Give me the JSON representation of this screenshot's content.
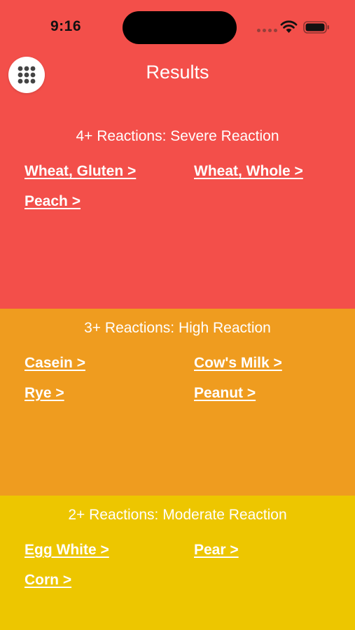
{
  "status": {
    "time": "9:16"
  },
  "header": {
    "title": "Results",
    "menu_icon": "grid-dots-icon"
  },
  "colors": {
    "severe": "#f34f4a",
    "high": "#ef9c1f",
    "moderate": "#edc600",
    "text": "#ffffff"
  },
  "sections": [
    {
      "title": "4+ Reactions: Severe Reaction",
      "items": [
        "Wheat, Gluten >",
        "Wheat, Whole >",
        "Peach >"
      ]
    },
    {
      "title": "3+ Reactions: High Reaction",
      "items": [
        "Casein >",
        "Cow's Milk >",
        "Rye >",
        "Peanut >"
      ]
    },
    {
      "title": "2+ Reactions: Moderate Reaction",
      "items": [
        "Egg White >",
        "Pear >",
        "Corn >"
      ]
    }
  ]
}
